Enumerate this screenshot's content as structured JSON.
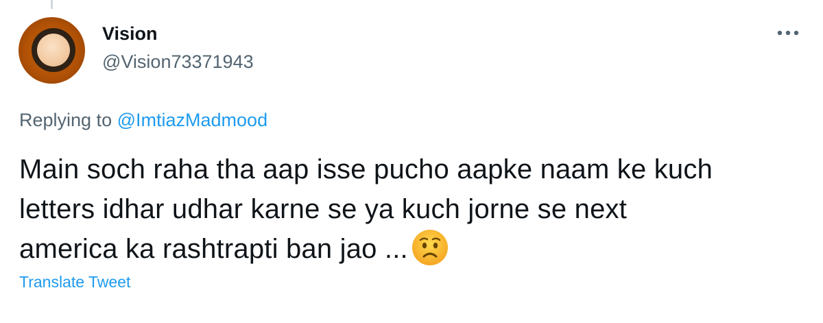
{
  "user": {
    "display_name": "Vision",
    "handle": "@Vision73371943",
    "avatar_icon": "avatar-photo"
  },
  "more_icon": "more-dots-icon",
  "reply": {
    "prefix": "Replying to",
    "mention": "@ImtiazMadmood"
  },
  "tweet": {
    "lines": [
      "Main soch raha tha aap isse pucho aapke naam ke kuch",
      "letters idhar udhar karne se ya kuch jorne se next",
      "america ka rashtrapti ban jao ..."
    ],
    "emoji": "worried-face-icon"
  },
  "translate_label": "Translate Tweet",
  "colors": {
    "text": "#0f1419",
    "secondary": "#536471",
    "link": "#1d9bf0",
    "divider": "#cfd9de"
  }
}
